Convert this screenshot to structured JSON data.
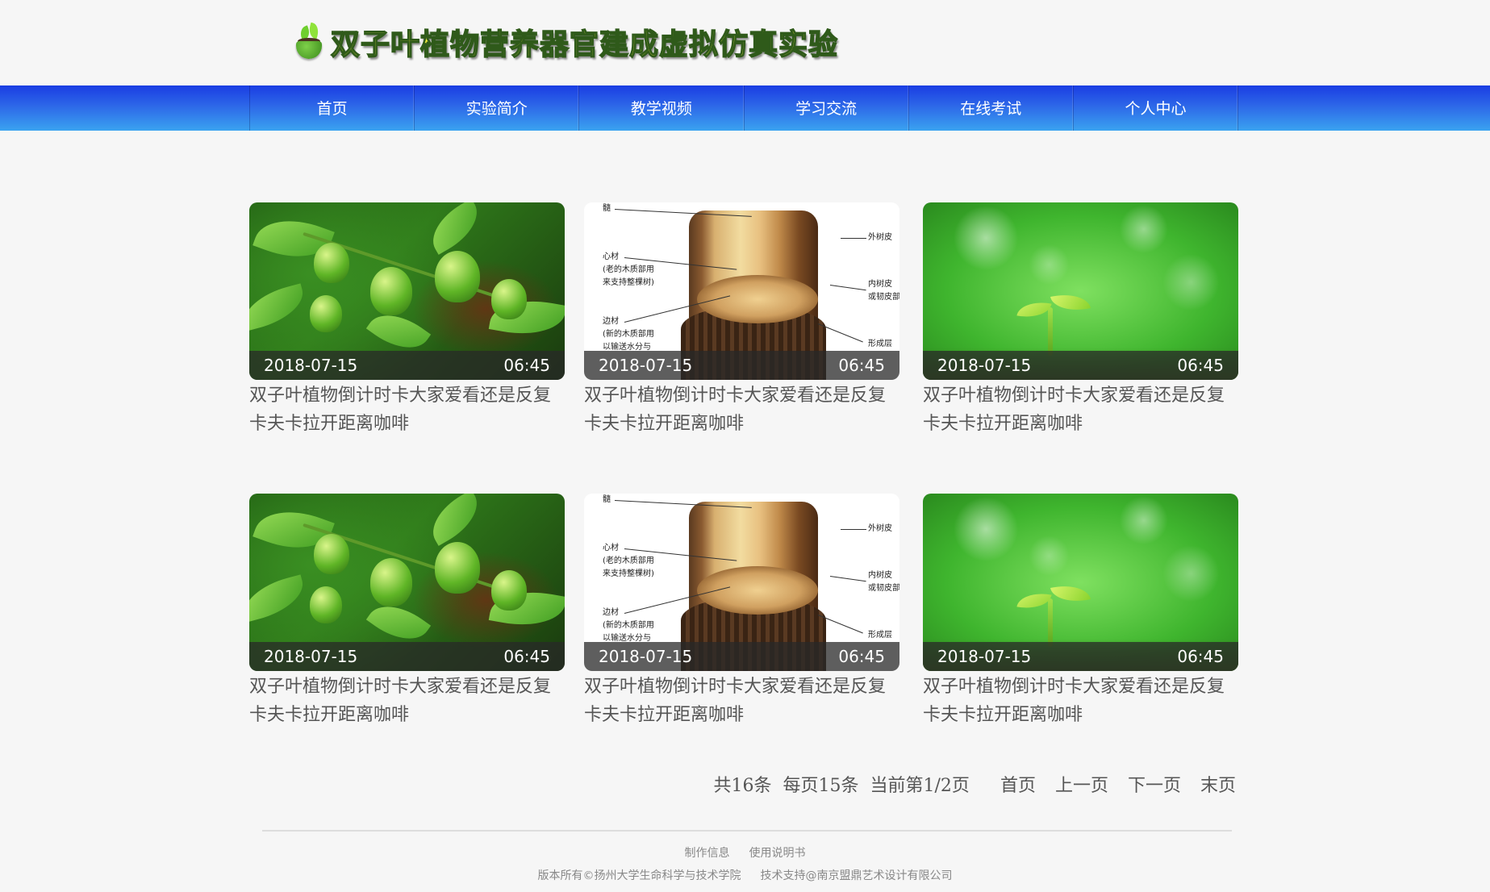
{
  "header": {
    "title": "双子叶植物营养器官建成虚拟仿真实验",
    "logo_icon": "sprout-cup-icon"
  },
  "nav": {
    "items": [
      {
        "label": "首页"
      },
      {
        "label": "实验简介"
      },
      {
        "label": "教学视频"
      },
      {
        "label": "学习交流"
      },
      {
        "label": "在线考试"
      },
      {
        "label": "个人中心"
      }
    ]
  },
  "videos": [
    {
      "date": "2018-07-15",
      "duration": "06:45",
      "title": "双子叶植物倒计时卡大家爱看还是反复卡夫卡拉开距离咖啡",
      "image": "plant"
    },
    {
      "date": "2018-07-15",
      "duration": "06:45",
      "title": "双子叶植物倒计时卡大家爱看还是反复卡夫卡拉开距离咖啡",
      "image": "trunk-diagram"
    },
    {
      "date": "2018-07-15",
      "duration": "06:45",
      "title": "双子叶植物倒计时卡大家爱看还是反复卡夫卡拉开距离咖啡",
      "image": "sprout"
    },
    {
      "date": "2018-07-15",
      "duration": "06:45",
      "title": "双子叶植物倒计时卡大家爱看还是反复卡夫卡拉开距离咖啡",
      "image": "plant"
    },
    {
      "date": "2018-07-15",
      "duration": "06:45",
      "title": "双子叶植物倒计时卡大家爱看还是反复卡夫卡拉开距离咖啡",
      "image": "trunk-diagram"
    },
    {
      "date": "2018-07-15",
      "duration": "06:45",
      "title": "双子叶植物倒计时卡大家爱看还是反复卡夫卡拉开距离咖啡",
      "image": "sprout"
    }
  ],
  "trunk_labels": {
    "pith": "髓",
    "outer_bark": "外树皮",
    "heartwood": "心材",
    "heartwood_note1": "(老的木质部用",
    "heartwood_note2": "来支持整棵树)",
    "inner_bark": "内树皮",
    "inner_bark_note": "或韧皮部",
    "sapwood": "边材",
    "sapwood_note1": "(新的木质部用",
    "sapwood_note2": "以输送水分与",
    "cambium": "形成层"
  },
  "pagination": {
    "total": "共16条",
    "per_page": "每页15条",
    "current": "当前第1/2页",
    "first": "首页",
    "prev": "上一页",
    "next": "下一页",
    "last": "末页"
  },
  "footer": {
    "links": [
      "制作信息",
      "使用说明书"
    ],
    "copyright": "版本所有©扬州大学生命科学与技术学院",
    "support": "技术支持@南京盟鼎艺术设计有限公司"
  }
}
